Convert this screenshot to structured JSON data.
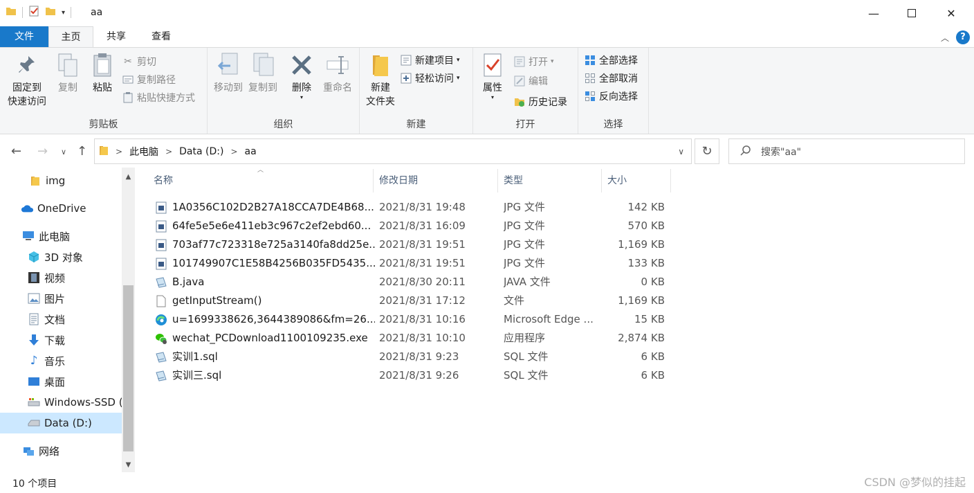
{
  "window": {
    "title": "aa"
  },
  "ribbon_tabs": [
    "文件",
    "主页",
    "共享",
    "查看"
  ],
  "ribbon": {
    "clipboard": {
      "label": "剪贴板",
      "pin": [
        "固定到",
        "快速访问"
      ],
      "copy": "复制",
      "paste": "粘贴",
      "cut": "剪切",
      "copy_path": "复制路径",
      "paste_shortcut": "粘贴快捷方式"
    },
    "organize": {
      "label": "组织",
      "move_to": "移动到",
      "copy_to": "复制到",
      "delete": "删除",
      "rename": "重命名"
    },
    "new": {
      "label": "新建",
      "new_folder": [
        "新建",
        "文件夹"
      ],
      "new_item": "新建项目",
      "easy_access": "轻松访问"
    },
    "open": {
      "label": "打开",
      "properties": "属性",
      "open": "打开",
      "edit": "编辑",
      "history": "历史记录"
    },
    "select": {
      "label": "选择",
      "select_all": "全部选择",
      "select_none": "全部取消",
      "invert": "反向选择"
    }
  },
  "address": {
    "crumbs": [
      "此电脑",
      "Data (D:)",
      "aa"
    ],
    "search_placeholder": "搜索\"aa\""
  },
  "navpane": [
    {
      "label": "img",
      "icon": "folder-icon"
    },
    {
      "label": "OneDrive",
      "icon": "cloud-icon"
    },
    {
      "label": "此电脑",
      "icon": "computer-icon"
    },
    {
      "label": "3D 对象",
      "icon": "cube-icon"
    },
    {
      "label": "视频",
      "icon": "film-icon"
    },
    {
      "label": "图片",
      "icon": "picture-icon"
    },
    {
      "label": "文档",
      "icon": "document-icon"
    },
    {
      "label": "下载",
      "icon": "download-icon"
    },
    {
      "label": "音乐",
      "icon": "music-icon"
    },
    {
      "label": "桌面",
      "icon": "desktop-icon"
    },
    {
      "label": "Windows-SSD (",
      "icon": "drive-icon"
    },
    {
      "label": "Data (D:)",
      "icon": "drive-icon",
      "selected": true
    },
    {
      "label": "网络",
      "icon": "network-icon"
    }
  ],
  "columns": {
    "name": "名称",
    "date": "修改日期",
    "type": "类型",
    "size": "大小"
  },
  "files": [
    {
      "name": "1A0356C102D2B27A18CCA7DE4B68...",
      "date": "2021/8/31 19:48",
      "type": "JPG 文件",
      "size": "142 KB",
      "icon": "image-file-icon"
    },
    {
      "name": "64fe5e5e6e411eb3c967c2ef2ebd60...",
      "date": "2021/8/31 16:09",
      "type": "JPG 文件",
      "size": "570 KB",
      "icon": "image-file-icon"
    },
    {
      "name": "703af77c723318e725a3140fa8dd25e...",
      "date": "2021/8/31 19:51",
      "type": "JPG 文件",
      "size": "1,169 KB",
      "icon": "image-file-icon"
    },
    {
      "name": "101749907C1E58B4256B035FD5435...",
      "date": "2021/8/31 19:51",
      "type": "JPG 文件",
      "size": "133 KB",
      "icon": "image-file-icon"
    },
    {
      "name": "B.java",
      "date": "2021/8/30 20:11",
      "type": "JAVA 文件",
      "size": "0 KB",
      "icon": "script-file-icon"
    },
    {
      "name": "getInputStream()",
      "date": "2021/8/31 17:12",
      "type": "文件",
      "size": "1,169 KB",
      "icon": "blank-file-icon"
    },
    {
      "name": "u=1699338626,3644389086&fm=26...",
      "date": "2021/8/31 10:16",
      "type": "Microsoft Edge ...",
      "size": "15 KB",
      "icon": "edge-icon"
    },
    {
      "name": "wechat_PCDownload1100109235.exe",
      "date": "2021/8/31 10:10",
      "type": "应用程序",
      "size": "2,874 KB",
      "icon": "wechat-icon"
    },
    {
      "name": "实训1.sql",
      "date": "2021/8/31 9:23",
      "type": "SQL 文件",
      "size": "6 KB",
      "icon": "script-file-icon"
    },
    {
      "name": "实训三.sql",
      "date": "2021/8/31 9:26",
      "type": "SQL 文件",
      "size": "6 KB",
      "icon": "script-file-icon"
    }
  ],
  "status": {
    "count": "10 个项目"
  },
  "watermark": "CSDN @梦似的挂起"
}
